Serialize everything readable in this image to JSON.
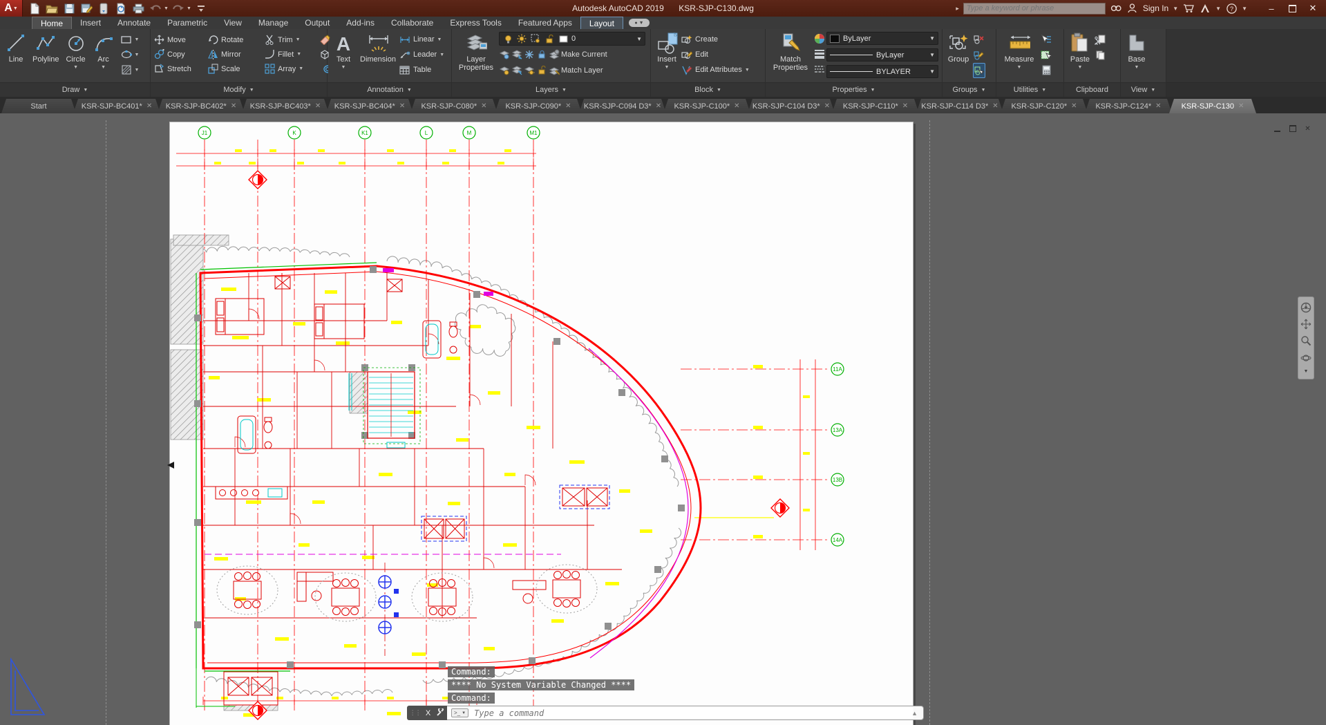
{
  "title_bar": {
    "app_title": "Autodesk AutoCAD 2019",
    "doc_title": "KSR-SJP-C130.dwg",
    "search_placeholder": "Type a keyword or phrase",
    "sign_in_label": "Sign In"
  },
  "ribbon": {
    "tabs": [
      {
        "label": "Home",
        "active": true
      },
      {
        "label": "Insert"
      },
      {
        "label": "Annotate"
      },
      {
        "label": "Parametric"
      },
      {
        "label": "View"
      },
      {
        "label": "Manage"
      },
      {
        "label": "Output"
      },
      {
        "label": "Add-ins"
      },
      {
        "label": "Collaborate"
      },
      {
        "label": "Express Tools"
      },
      {
        "label": "Featured Apps"
      },
      {
        "label": "Layout",
        "highlighted": true
      }
    ],
    "draw": {
      "label": "Draw",
      "buttons": [
        "Line",
        "Polyline",
        "Circle",
        "Arc"
      ]
    },
    "modify": {
      "label": "Modify",
      "grid": [
        "Move",
        "Rotate",
        "Trim",
        "Copy",
        "Mirror",
        "Fillet",
        "Stretch",
        "Scale",
        "Array"
      ]
    },
    "annotation": {
      "label": "Annotation",
      "text": "Text",
      "dimension": "Dimension",
      "small": [
        "Linear",
        "Leader",
        "Table"
      ]
    },
    "layers": {
      "label": "Layers",
      "layer_properties": "Layer Properties",
      "current_layer": "0",
      "make_current": "Make Current",
      "match_layer": "Match Layer"
    },
    "block": {
      "label": "Block",
      "insert": "Insert",
      "small": [
        "Create",
        "Edit",
        "Edit Attributes"
      ]
    },
    "properties_panel": {
      "label": "Properties",
      "match_properties": "Match Properties",
      "color": "ByLayer",
      "lineweight": "ByLayer",
      "linetype": "BYLAYER"
    },
    "groups": {
      "label": "Groups",
      "group": "Group"
    },
    "utilities": {
      "label": "Utilities",
      "measure": "Measure"
    },
    "clipboard": {
      "label": "Clipboard",
      "paste": "Paste"
    },
    "view": {
      "label": "View",
      "base": "Base"
    }
  },
  "file_tabs": [
    {
      "label": "Start",
      "closable": false
    },
    {
      "label": "KSR-SJP-BC401*",
      "closable": true
    },
    {
      "label": "KSR-SJP-BC402*",
      "closable": true
    },
    {
      "label": "KSR-SJP-BC403*",
      "closable": true
    },
    {
      "label": "KSR-SJP-BC404*",
      "closable": true
    },
    {
      "label": "KSR-SJP-C080*",
      "closable": true
    },
    {
      "label": "KSR-SJP-C090*",
      "closable": true
    },
    {
      "label": "KSR-SJP-C094 D3*",
      "closable": true
    },
    {
      "label": "KSR-SJP-C100*",
      "closable": true
    },
    {
      "label": "KSR-SJP-C104 D3*",
      "closable": true
    },
    {
      "label": "KSR-SJP-C110*",
      "closable": true
    },
    {
      "label": "KSR-SJP-C114 D3*",
      "closable": true
    },
    {
      "label": "KSR-SJP-C120*",
      "closable": true
    },
    {
      "label": "KSR-SJP-C124*",
      "closable": true
    },
    {
      "label": "KSR-SJP-C130",
      "closable": true,
      "active": true
    }
  ],
  "drawing": {
    "grid_bubbles_top": [
      "J1",
      "K",
      "K1",
      "L",
      "M",
      "M1"
    ],
    "grid_bubbles_right": [
      "11A",
      "13A",
      "13B",
      "14A"
    ]
  },
  "command_line": {
    "history": [
      "Command:",
      "**** No System Variable Changed ****",
      "Command:"
    ],
    "placeholder": "Type a command"
  },
  "colors": {
    "title_bar": "#4c1c0e",
    "ribbon": "#3c3c3c",
    "accent_blue": "#4d9fd6",
    "cad_red": "#ff0000",
    "cad_green": "#00c000",
    "cad_cyan": "#00c8c8",
    "cad_yellow": "#ffff00",
    "cad_magenta": "#e100e1",
    "paper": "#fdfdfd"
  }
}
